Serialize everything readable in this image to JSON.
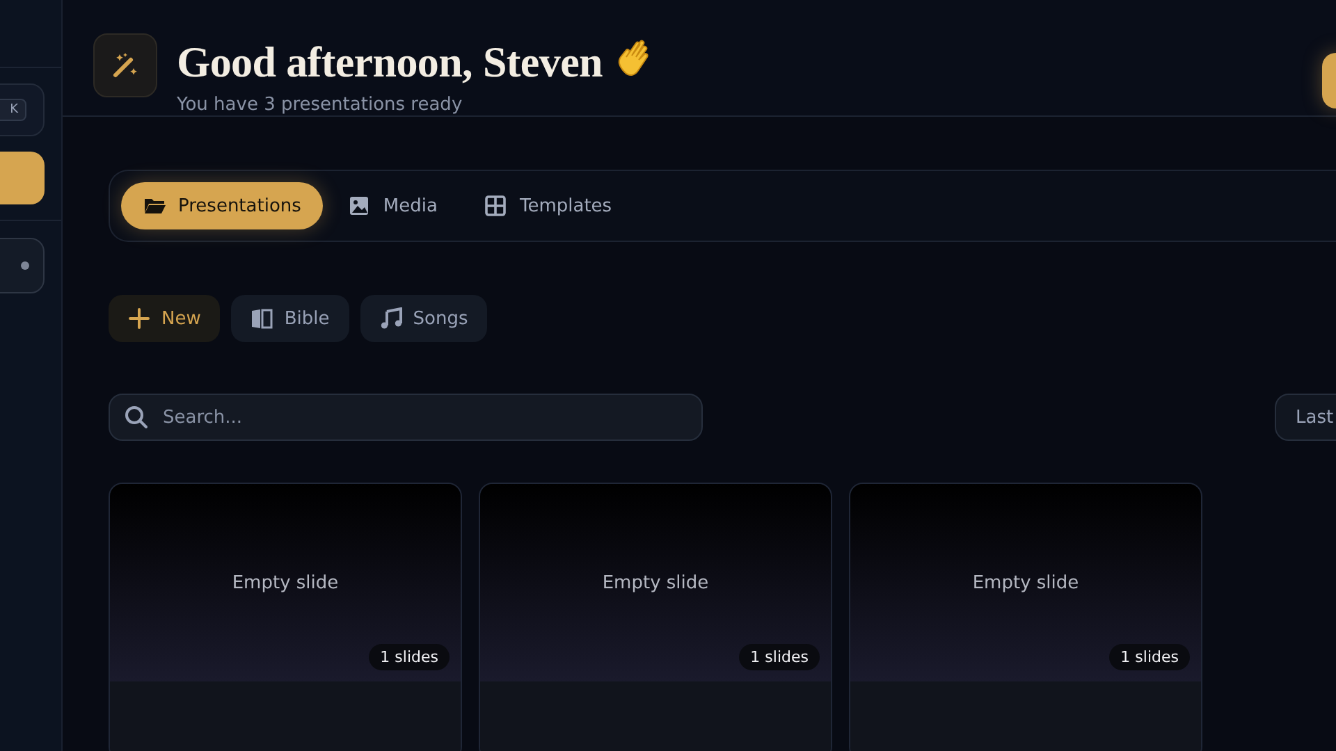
{
  "sidebar": {
    "shortcut_key": "K"
  },
  "header": {
    "title": "Good afternoon, Steven",
    "subtitle": "You have 3 presentations ready"
  },
  "tabs": [
    {
      "label": "Presentations",
      "selected": true
    },
    {
      "label": "Media",
      "selected": false
    },
    {
      "label": "Templates",
      "selected": false
    }
  ],
  "actions": [
    {
      "label": "New",
      "kind": "primary"
    },
    {
      "label": "Bible",
      "kind": "plain"
    },
    {
      "label": "Songs",
      "kind": "plain"
    }
  ],
  "search": {
    "placeholder": "Search..."
  },
  "sort_button": "Last",
  "cards": [
    {
      "preview": "Empty slide",
      "badge": "1 slides"
    },
    {
      "preview": "Empty slide",
      "badge": "1 slides"
    },
    {
      "preview": "Empty slide",
      "badge": "1 slides"
    }
  ]
}
